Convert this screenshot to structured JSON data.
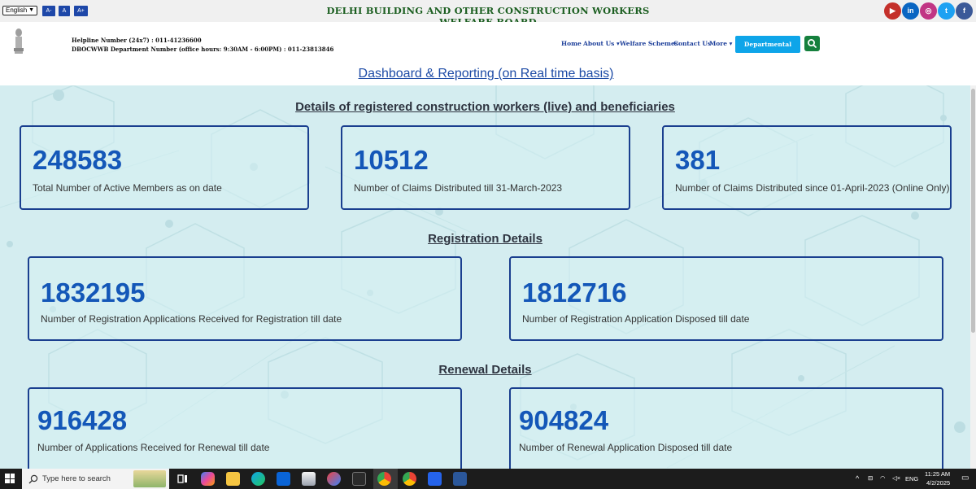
{
  "topbar": {
    "language": "English",
    "font_buttons": [
      "A-",
      "A",
      "A+"
    ],
    "board_title": "DELHI BUILDING AND OTHER CONSTRUCTION WORKERS WELFARE BOARD",
    "social_icons": [
      "youtube-icon",
      "linkedin-icon",
      "instagram-icon",
      "twitter-icon",
      "facebook-icon"
    ],
    "social_labels": [
      "▶",
      "in",
      "◎",
      "t",
      "f"
    ],
    "social_colors": [
      "#c4302b",
      "#0a66c2",
      "#c13584",
      "#1da1f2",
      "#3b5998"
    ]
  },
  "header": {
    "helpline": "Helpline Number (24x7) : 011-41236600",
    "dept_number": "DBOCWWB Department Number (office hours: 9:30AM - 6:00PM) : 011-23813846",
    "nav": [
      "Home",
      "About Us",
      "Welfare Schemes",
      "Contact Us",
      "More"
    ],
    "dept_login": "Departmental Login",
    "dashboard_title": "Dashboard & Reporting (on Real time basis)"
  },
  "sections": {
    "beneficiaries_heading": "Details of registered construction workers (live) and beneficiaries",
    "registration_heading": "Registration Details",
    "renewal_heading": "Renewal Details"
  },
  "cards": {
    "active_members": {
      "value": "248583",
      "label": "Total Number of Active Members as on date"
    },
    "claims_till": {
      "value": "10512",
      "label": "Number of Claims Distributed till 31-March-2023"
    },
    "claims_since": {
      "value": "381",
      "label": "Number of Claims Distributed since 01-April-2023 (Online Only)"
    },
    "reg_received": {
      "value": "1832195",
      "label": "Number of Registration Applications Received for Registration till date"
    },
    "reg_disposed": {
      "value": "1812716",
      "label": "Number of Registration Application Disposed till date"
    },
    "renew_received": {
      "value": "916428",
      "label": "Number of Applications Received for Renewal till date"
    },
    "renew_disposed": {
      "value": "904824",
      "label": "Number of Renewal Application Disposed till date"
    }
  },
  "taskbar": {
    "search_placeholder": "Type here to search",
    "lang": "ENG",
    "time": "11:25 AM",
    "date": "4/2/2025"
  }
}
